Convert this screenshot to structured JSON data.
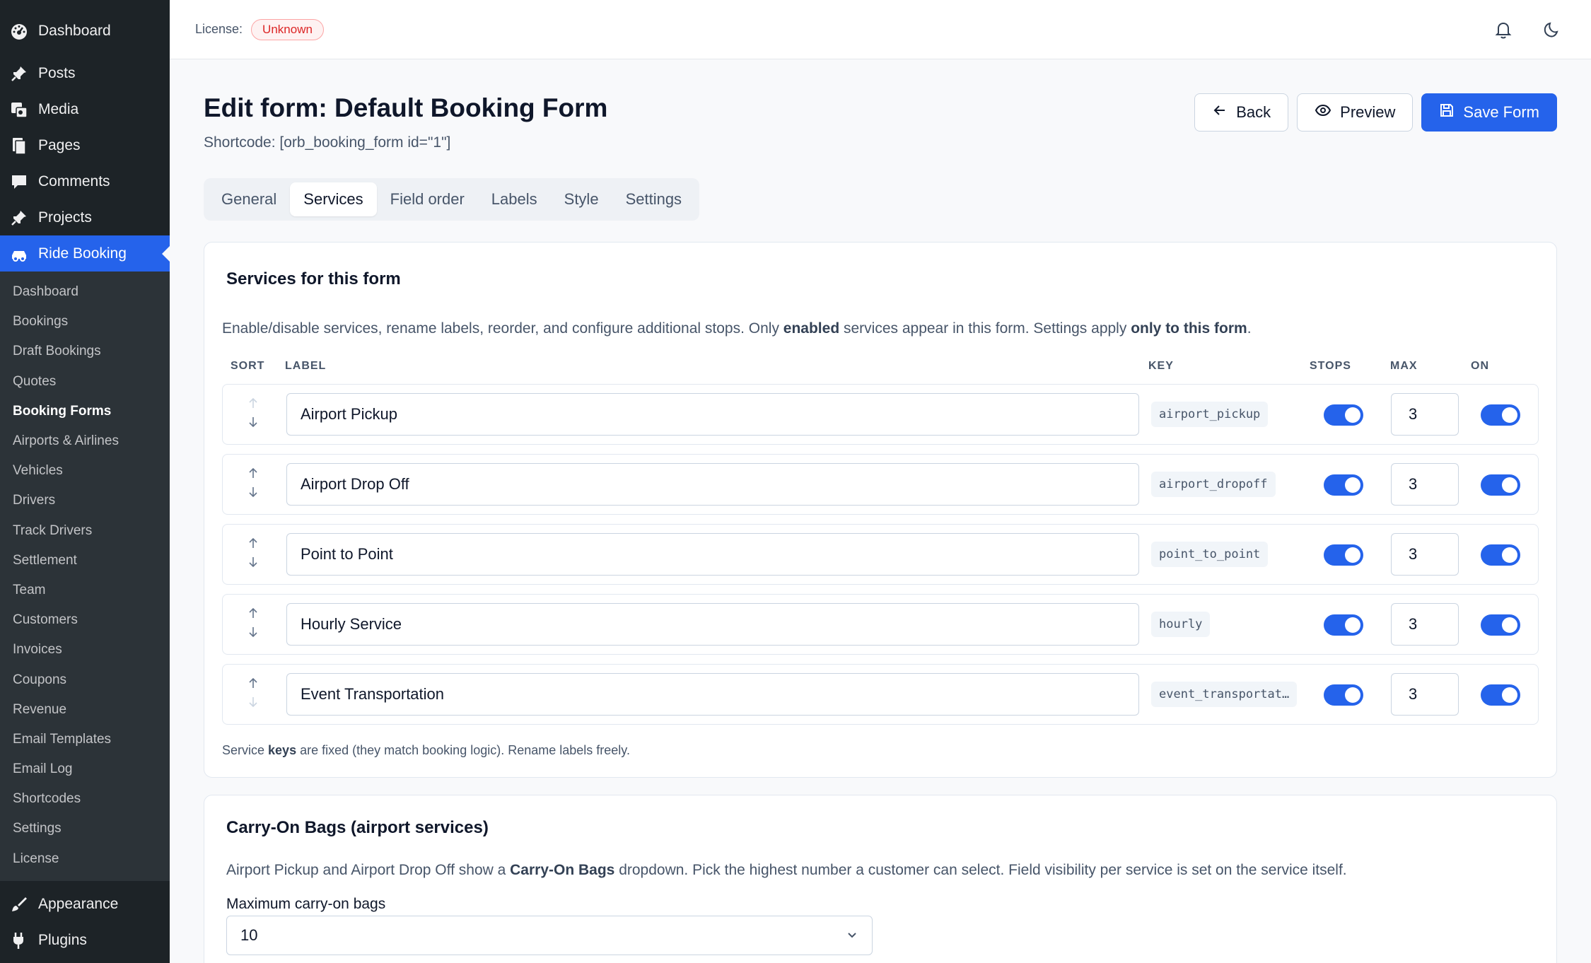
{
  "sidebar": {
    "top_items": [
      {
        "label": "Dashboard",
        "icon": "dashboard-icon"
      },
      {
        "label": "Posts",
        "icon": "pin-icon"
      },
      {
        "label": "Media",
        "icon": "media-icon"
      },
      {
        "label": "Pages",
        "icon": "pages-icon"
      },
      {
        "label": "Comments",
        "icon": "comment-icon"
      },
      {
        "label": "Projects",
        "icon": "pin-icon"
      },
      {
        "label": "Ride Booking",
        "icon": "car-icon"
      }
    ],
    "submenu": [
      "Dashboard",
      "Bookings",
      "Draft Bookings",
      "Quotes",
      "Booking Forms",
      "Airports & Airlines",
      "Vehicles",
      "Drivers",
      "Track Drivers",
      "Settlement",
      "Team",
      "Customers",
      "Invoices",
      "Coupons",
      "Revenue",
      "Email Templates",
      "Email Log",
      "Shortcodes",
      "Settings",
      "License"
    ],
    "current_submenu": "Booking Forms",
    "bottom_items": [
      {
        "label": "Appearance",
        "icon": "brush-icon"
      },
      {
        "label": "Plugins",
        "icon": "plugin-icon"
      }
    ]
  },
  "topbar": {
    "license_label": "License:",
    "license_status": "Unknown"
  },
  "header": {
    "title": "Edit form: Default Booking Form",
    "shortcode": "Shortcode: [orb_booking_form id=\"1\"]",
    "back_label": "Back",
    "preview_label": "Preview",
    "save_label": "Save Form"
  },
  "tabs": [
    "General",
    "Services",
    "Field order",
    "Labels",
    "Style",
    "Settings"
  ],
  "active_tab": "Services",
  "services_card": {
    "title": "Services for this form",
    "desc_1": "Enable/disable services, rename labels, reorder, and configure additional stops. Only ",
    "desc_bold_1": "enabled",
    "desc_2": " services appear in this form. Settings apply ",
    "desc_bold_2": "only to this form",
    "desc_3": ".",
    "columns": {
      "sort": "SORT",
      "label": "LABEL",
      "key": "KEY",
      "stops": "STOPS",
      "max": "MAX",
      "on": "ON"
    },
    "rows": [
      {
        "label": "Airport Pickup",
        "key": "airport_pickup",
        "stops": true,
        "max": "3",
        "on": true
      },
      {
        "label": "Airport Drop Off",
        "key": "airport_dropoff",
        "stops": true,
        "max": "3",
        "on": true
      },
      {
        "label": "Point to Point",
        "key": "point_to_point",
        "stops": true,
        "max": "3",
        "on": true
      },
      {
        "label": "Hourly Service",
        "key": "hourly",
        "stops": true,
        "max": "3",
        "on": true
      },
      {
        "label": "Event Transportation",
        "key": "event_transportat…",
        "stops": true,
        "max": "3",
        "on": true
      }
    ],
    "note_1": "Service ",
    "note_bold": "keys",
    "note_2": " are fixed (they match booking logic). Rename labels freely."
  },
  "carry_card": {
    "title": "Carry-On Bags (airport services)",
    "desc_1": "Airport Pickup and Airport Drop Off show a ",
    "desc_bold": "Carry-On Bags",
    "desc_2": " dropdown. Pick the highest number a customer can select. Field visibility per service is set on the service itself.",
    "field_label": "Maximum carry-on bags",
    "selected": "10"
  },
  "colors": {
    "accent": "#2563eb",
    "sidebar": "#1d2327",
    "submenu": "#2c3338"
  }
}
